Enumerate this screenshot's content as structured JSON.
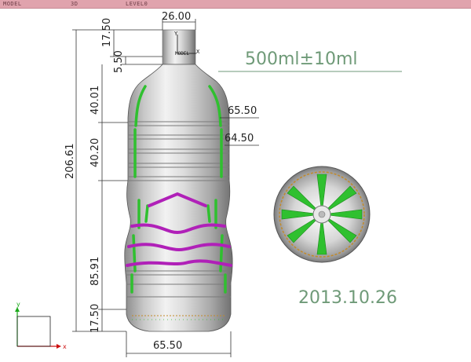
{
  "viewport_bar": {
    "mode": "MODEL",
    "view": "3D",
    "level": "LEVEL0"
  },
  "volume_label": "500ml±10ml",
  "date_label": "2013.10.26",
  "dimensions": {
    "top_width": "26.00",
    "neck_height": "17.50",
    "ring_offset": "5.50",
    "shoulder_height": "40.01",
    "ribs_height": "40.20",
    "total_height": "206.61",
    "lower_height": "85.91",
    "base_height": "17.50",
    "shoulder_diameter": "65.50",
    "rib_diameter": "64.50",
    "base_diameter": "65.50"
  },
  "model_label": "MODEL",
  "triad": {
    "axis_x": "X",
    "axis_y": "Y"
  },
  "ucs": {
    "axis_x": "x",
    "axis_y": "y"
  },
  "colors": {
    "title_bar": "#e0a3ad",
    "rib_green": "#2fc02f",
    "band_purple": "#b020b8",
    "volume_text": "#6f9a78",
    "x_axis": "#cc1111",
    "y_axis": "#1aa81a"
  }
}
